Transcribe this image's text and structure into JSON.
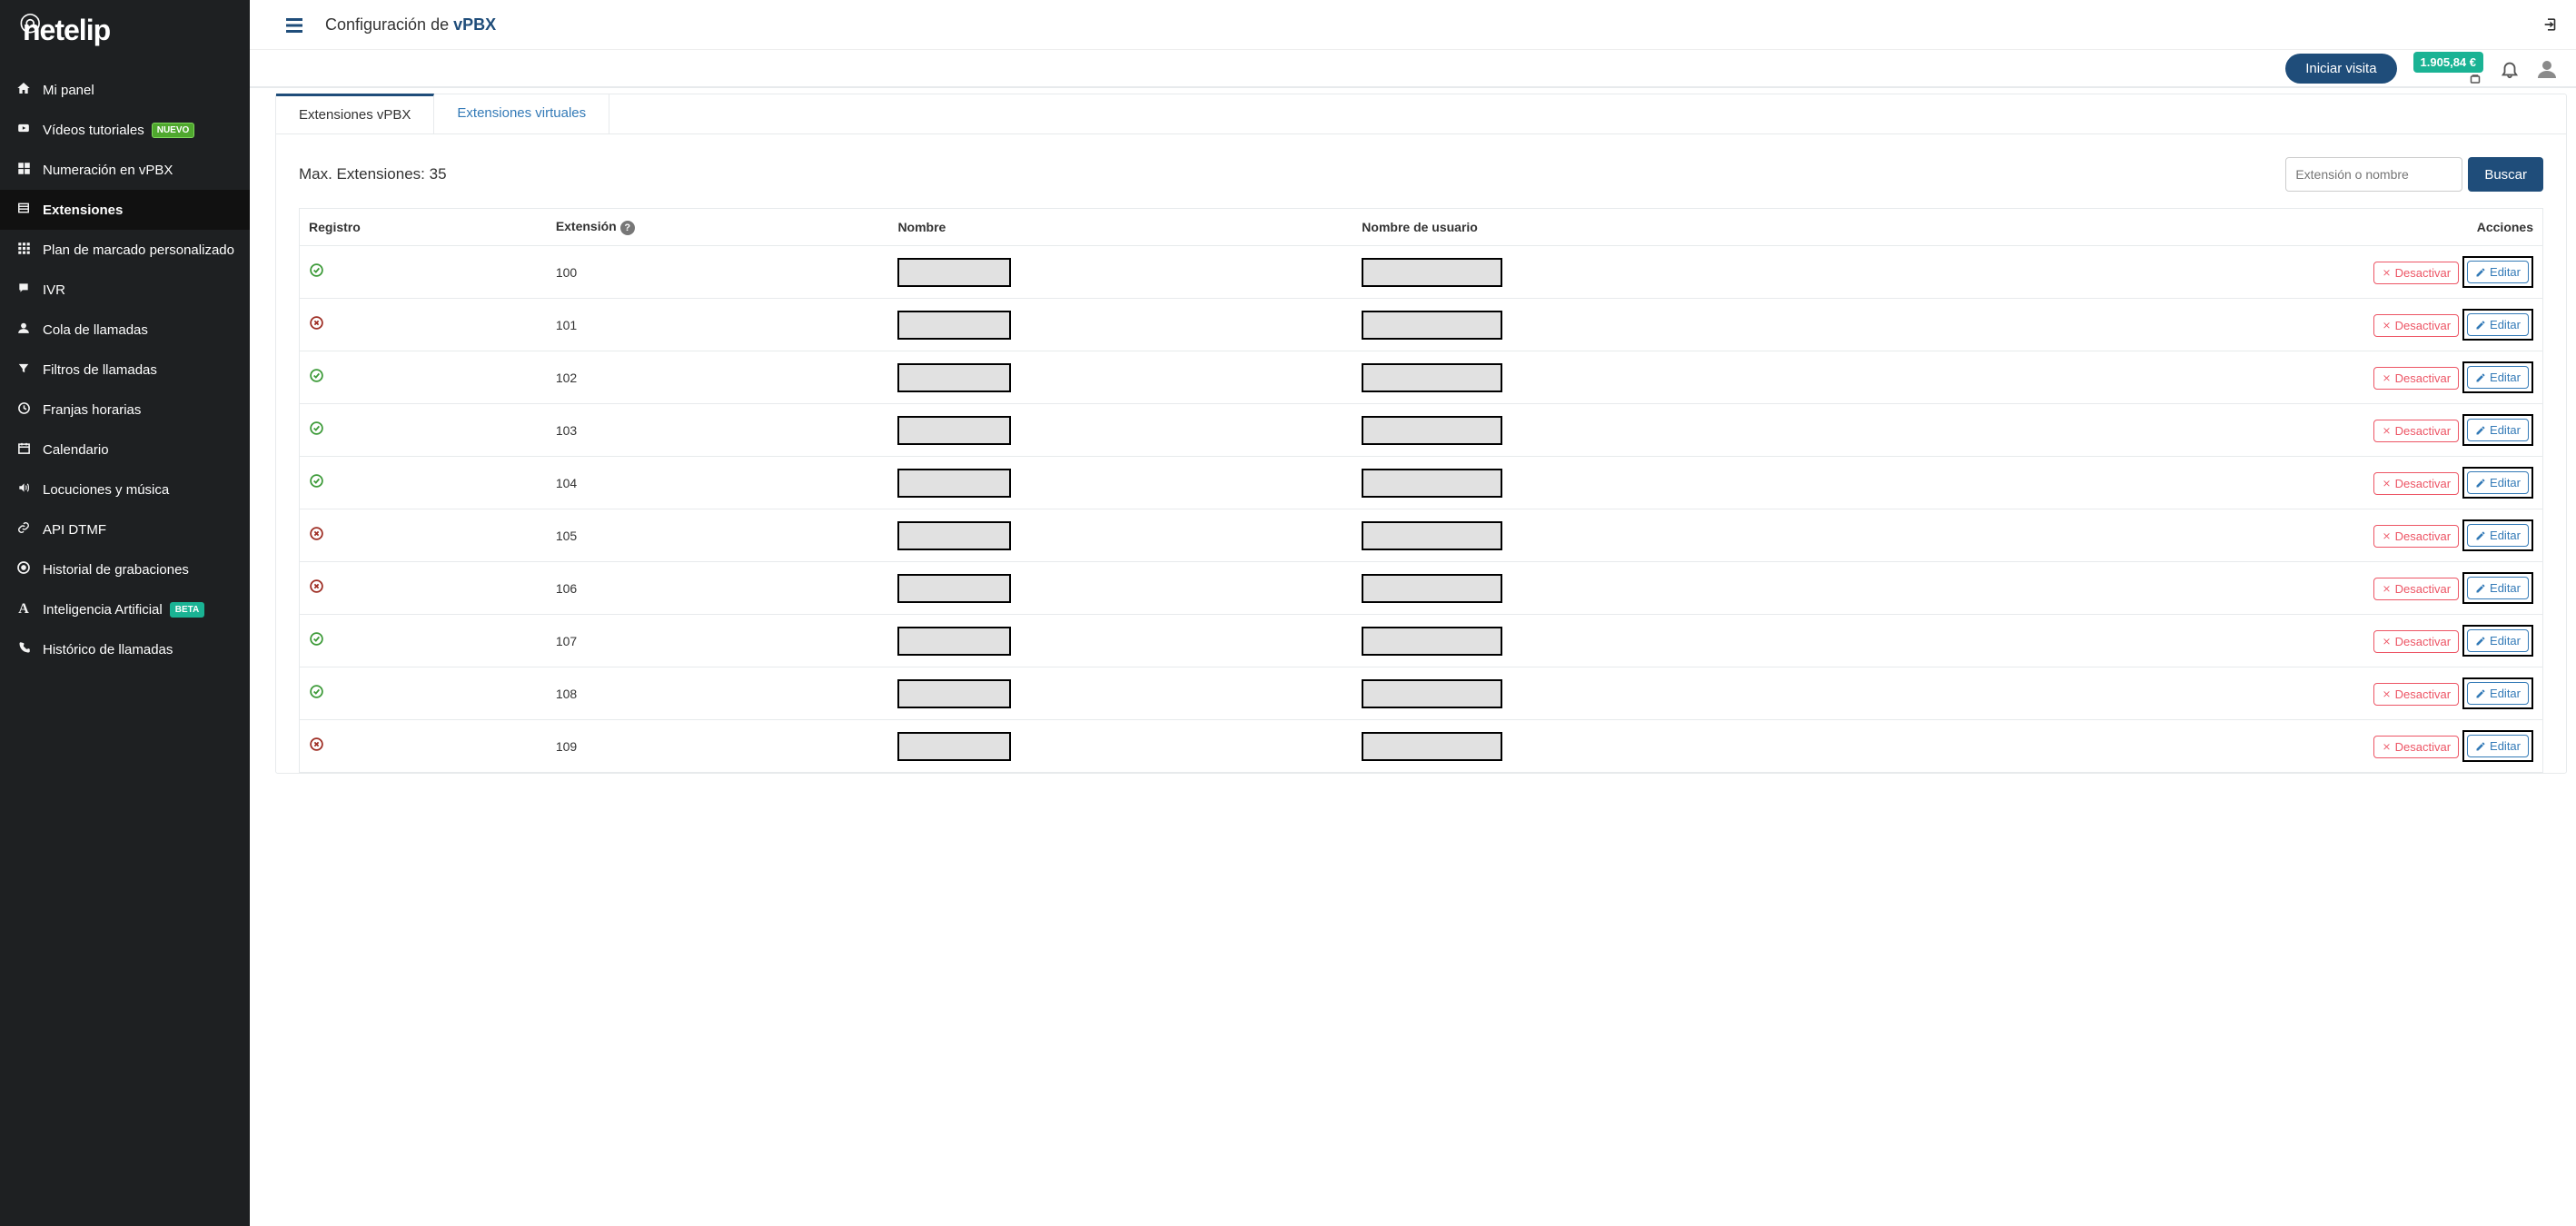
{
  "brand": "netelip",
  "header": {
    "title_prefix": "Configuración de ",
    "title_bold": "vPBX",
    "visit_button": "Iniciar visita",
    "balance": "1.905,84 €"
  },
  "sidebar": {
    "items": [
      {
        "icon": "home",
        "label": "Mi panel"
      },
      {
        "icon": "youtube",
        "label": "Vídeos tutoriales",
        "badge": "NUEVO",
        "badge_cls": "green"
      },
      {
        "icon": "grid",
        "label": "Numeración en vPBX"
      },
      {
        "icon": "list",
        "label": "Extensiones",
        "active": true
      },
      {
        "icon": "grid2",
        "label": "Plan de marcado personalizado"
      },
      {
        "icon": "chat",
        "label": "IVR"
      },
      {
        "icon": "user",
        "label": "Cola de llamadas"
      },
      {
        "icon": "filter",
        "label": "Filtros de llamadas"
      },
      {
        "icon": "clock",
        "label": "Franjas horarias"
      },
      {
        "icon": "calendar",
        "label": "Calendario"
      },
      {
        "icon": "volume",
        "label": "Locuciones y música"
      },
      {
        "icon": "link",
        "label": "API DTMF"
      },
      {
        "icon": "target",
        "label": "Historial de grabaciones"
      },
      {
        "icon": "ai",
        "label": "Inteligencia Artificial",
        "badge": "BETA",
        "badge_cls": "teal"
      },
      {
        "icon": "phone",
        "label": "Histórico de llamadas"
      }
    ]
  },
  "tabs": [
    {
      "label": "Extensiones vPBX",
      "active": true
    },
    {
      "label": "Extensiones virtuales",
      "active": false
    }
  ],
  "content": {
    "max_label": "Max. Extensiones: 35",
    "search_placeholder": "Extensión o nombre",
    "search_button": "Buscar",
    "columns": [
      "Registro",
      "Extensión",
      "Nombre",
      "Nombre de usuario",
      "Acciones"
    ],
    "deactivate_label": "Desactivar",
    "edit_label": "Editar",
    "rows": [
      {
        "registered": true,
        "ext": "100"
      },
      {
        "registered": false,
        "ext": "101"
      },
      {
        "registered": true,
        "ext": "102"
      },
      {
        "registered": true,
        "ext": "103"
      },
      {
        "registered": true,
        "ext": "104"
      },
      {
        "registered": false,
        "ext": "105"
      },
      {
        "registered": false,
        "ext": "106"
      },
      {
        "registered": true,
        "ext": "107"
      },
      {
        "registered": true,
        "ext": "108"
      },
      {
        "registered": false,
        "ext": "109"
      }
    ]
  }
}
